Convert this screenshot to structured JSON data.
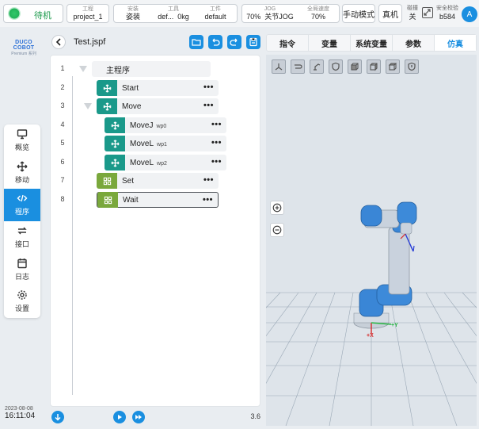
{
  "topbar": {
    "status_label": "待机",
    "project_label": "工程",
    "project_value": "project_1",
    "install_label": "安装",
    "install_value": "姿装",
    "tool_label": "工具",
    "tool_value": "def...",
    "tool_weight": "0kg",
    "workpiece_label": "工件",
    "workpiece_value": "default",
    "jog_label": "JOG",
    "jog_value": "70%",
    "jog_mode": "关节JOG",
    "global_speed_label": "全局速度",
    "global_speed_value": "70%",
    "mode_button": "手动模式",
    "real_button": "真机",
    "brake_label": "碰撞",
    "brake_value": "关",
    "safety_label": "安全校验",
    "safety_value": "b584",
    "avatar": "A"
  },
  "logo": {
    "main": "DUCO COBOT",
    "sub": "Premium 系列"
  },
  "nav": [
    {
      "label": "概览",
      "icon": "monitor-icon"
    },
    {
      "label": "移动",
      "icon": "move-icon"
    },
    {
      "label": "程序",
      "icon": "code-icon",
      "active": true
    },
    {
      "label": "接口",
      "icon": "swap-icon"
    },
    {
      "label": "日志",
      "icon": "calendar-icon"
    },
    {
      "label": "设置",
      "icon": "gear-icon"
    }
  ],
  "datetime": {
    "date": "2023-08-08",
    "time": "16:11:04"
  },
  "program": {
    "filename": "Test.jspf",
    "version": "3.6",
    "lines": [
      {
        "no": "1",
        "text": "主程序",
        "wp": ""
      },
      {
        "no": "2",
        "text": "Start",
        "wp": ""
      },
      {
        "no": "3",
        "text": "Move",
        "wp": ""
      },
      {
        "no": "4",
        "text": "MoveJ",
        "wp": "wp0"
      },
      {
        "no": "5",
        "text": "MoveL",
        "wp": "wp1"
      },
      {
        "no": "6",
        "text": "MoveL",
        "wp": "wp2"
      },
      {
        "no": "7",
        "text": "Set",
        "wp": ""
      },
      {
        "no": "8",
        "text": "Wait",
        "wp": ""
      }
    ]
  },
  "tabs": [
    "指令",
    "变量",
    "系统变量",
    "参数",
    "仿真"
  ],
  "sim": {
    "axis_x_label": "+X",
    "axis_y_label": "+Y",
    "robot_color": "#3a86d6"
  }
}
